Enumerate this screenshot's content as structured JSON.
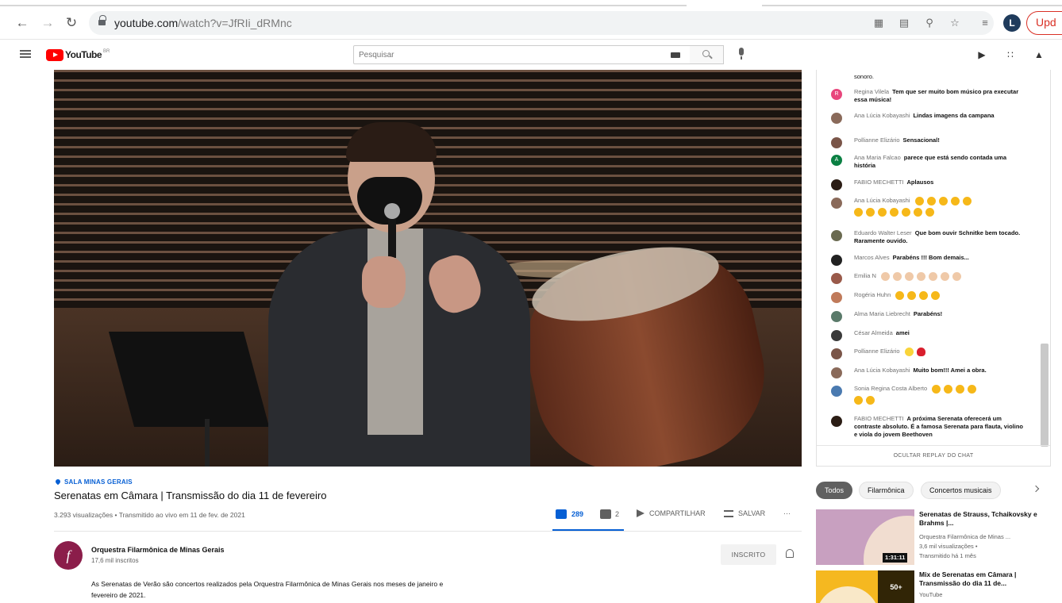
{
  "browser": {
    "url_domain": "youtube.com",
    "url_path": "/watch?v=JfRIi_dRMnc",
    "profile_initial": "L",
    "update_label": "Upd"
  },
  "header": {
    "logo_text": "YouTube",
    "country_code": "BR",
    "search_placeholder": "Pesquisar"
  },
  "video": {
    "location": "SALA MINAS GERAIS",
    "title": "Serenatas em Câmara | Transmissão do dia 11 de fevereiro",
    "views": "3.293 visualizações • Transmitido ao vivo em 11 de fev. de 2021",
    "likes": "289",
    "dislikes": "2",
    "share_label": "COMPARTILHAR",
    "save_label": "SALVAR",
    "more_label": "···"
  },
  "channel": {
    "initial": "f",
    "name": "Orquestra Filarmônica de Minas Gerais",
    "subscribers": "17,6 mil inscritos",
    "subscribed_label": "INSCRITO",
    "description": "As Serenatas de Verão são concertos realizados pela Orquestra Filarmônica de Minas Gerais nos meses de janeiro e fevereiro de 2021."
  },
  "chat": {
    "top_fragment": "sonoro.",
    "hide_label": "OCULTAR REPLAY DO CHAT",
    "messages": [
      {
        "author": "Regina Vilela",
        "text": "Tem que ser muito bom músico pra executar essa música!",
        "avatar_color": "#e8467c",
        "avatar_letter": "R"
      },
      {
        "author": "Ana Lúcia Kobayashi",
        "text": "Lindas imagens da campana",
        "avatar_color": "#8a6a5a",
        "avatar_letter": ""
      },
      {
        "author": "Pollianne Elizário",
        "text": "Sensacional!",
        "avatar_color": "#7a5548",
        "avatar_letter": ""
      },
      {
        "author": "Ana Maria Falcao",
        "text": "parece que está sendo contada uma história",
        "avatar_color": "#0b8043",
        "avatar_letter": "A"
      },
      {
        "author": "FABIO MECHETTI",
        "text": "Aplausos",
        "avatar_color": "#2b1d15",
        "avatar_letter": ""
      },
      {
        "author": "Ana Lúcia Kobayashi",
        "text": "",
        "avatar_color": "#8a6a5a",
        "avatar_letter": ""
      },
      {
        "author": "Eduardo Walter Leser",
        "text": "Que bom ouvir Schnitke bem tocado. Raramente ouvido.",
        "avatar_color": "#6a6a50",
        "avatar_letter": ""
      },
      {
        "author": "Marcos Alves",
        "text": "Parabéns !!! Bom demais...",
        "avatar_color": "#222222",
        "avatar_letter": ""
      },
      {
        "author": "Emilia N",
        "text": "",
        "avatar_color": "#9a5a4a",
        "avatar_letter": ""
      },
      {
        "author": "Rogéria Huhn",
        "text": "",
        "avatar_color": "#c07a5a",
        "avatar_letter": ""
      },
      {
        "author": "Alma Maria Liebrecht",
        "text": "Parabéns!",
        "avatar_color": "#5a7a6a",
        "avatar_letter": ""
      },
      {
        "author": "César Almeida",
        "text": "amei",
        "avatar_color": "#3a3a3a",
        "avatar_letter": ""
      },
      {
        "author": "Pollianne Elizário",
        "text": "",
        "avatar_color": "#7a5548",
        "avatar_letter": ""
      },
      {
        "author": "Ana Lúcia Kobayashi",
        "text": "Muito bom!!! Amei a obra.",
        "avatar_color": "#8a6a5a",
        "avatar_letter": ""
      },
      {
        "author": "Sonia Regina Costa Alberto",
        "text": "",
        "avatar_color": "#4a7ab0",
        "avatar_letter": ""
      },
      {
        "author": "FABIO MECHETTI",
        "text": "A próxima Serenata oferecerá um contraste absoluto. É a famosa Serenata para flauta, violino e viola do jovem Beethoven",
        "avatar_color": "#2b1d15",
        "avatar_letter": ""
      }
    ]
  },
  "chips": [
    "Todos",
    "Filarmônica",
    "Concertos musicais"
  ],
  "recommendations": [
    {
      "title": "Serenatas de Strauss, Tchaikovsky e Brahms |...",
      "channel": "Orquestra Filarmônica de Minas ...",
      "views": "3,6 mil visualizações •",
      "age": "Transmitido há 1 mês",
      "duration": "1:31:11"
    },
    {
      "title": "Mix de Serenatas em Câmara | Transmissão do dia 11 de...",
      "channel": "YouTube",
      "badge": "50+"
    }
  ],
  "icons": {
    "back": "back-arrow-icon",
    "forward": "forward-arrow-icon",
    "reload": "reload-icon",
    "lock": "lock-icon",
    "search": "search-icon",
    "mic": "microphone-icon",
    "create": "create-video-icon",
    "apps": "apps-grid-icon",
    "notifications": "bell-icon"
  },
  "colors": {
    "accent_blue": "#065fd4",
    "youtube_red": "#ff0000",
    "update_red": "#d93025"
  }
}
